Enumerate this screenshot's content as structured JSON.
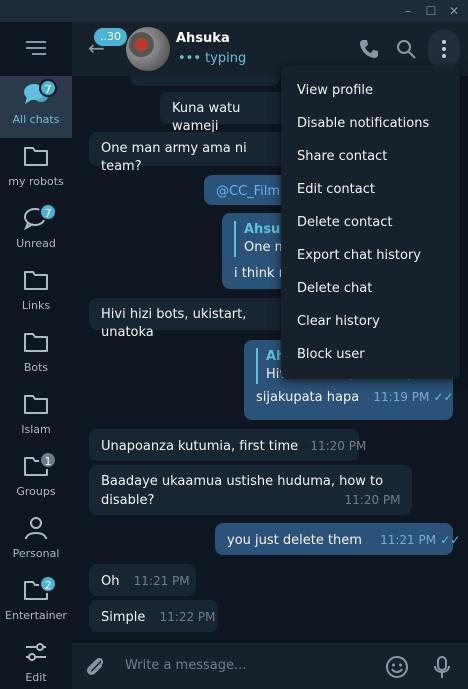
{
  "window": {
    "minimize_glyph": "–",
    "maximize_glyph": "☐",
    "close_glyph": "✕"
  },
  "sidebar": {
    "folders": [
      {
        "label": "All chats",
        "badge": "7",
        "icon": "chat-bubbles-icon",
        "active": true
      },
      {
        "label": "my robots",
        "badge": "",
        "icon": "folder-icon"
      },
      {
        "label": "Unread",
        "badge": "7",
        "icon": "chat-bubble-icon"
      },
      {
        "label": "Links",
        "badge": "",
        "icon": "folder-icon"
      },
      {
        "label": "Bots",
        "badge": "",
        "icon": "folder-icon"
      },
      {
        "label": "Islam",
        "badge": "",
        "icon": "folder-icon"
      },
      {
        "label": "Groups",
        "badge": "1",
        "icon": "folder-icon"
      },
      {
        "label": "Personal",
        "badge": "",
        "icon": "person-icon"
      },
      {
        "label": "Entertainer",
        "badge": "2",
        "icon": "folder-icon"
      },
      {
        "label": "Edit",
        "badge": "",
        "icon": "sliders-icon"
      }
    ]
  },
  "header": {
    "back_badge": "..30",
    "name": "Ahsuka",
    "status": "••• typing"
  },
  "messages": {
    "m1": {
      "text": "Kuna watu wameji"
    },
    "m2": {
      "text": "One man army ama ni team?"
    },
    "m3": {
      "text": "@CC_Filmo"
    },
    "m4": {
      "reply_name": "Ahsuk",
      "reply_text": "One m",
      "text": "i think n"
    },
    "m5": {
      "text": "Hivi hizi bots, ukistart, unatoka"
    },
    "m6": {
      "reply_name": "Ah",
      "reply_text": "Hivi hizi bots, ukistart, unat...",
      "text": "sijakupata hapa",
      "time": "11:19 PM"
    },
    "m7": {
      "text": "Unapoanza kutumia, first time",
      "time": "11:20 PM"
    },
    "m8": {
      "text_line1": "Baadaye ukaamua ustishe huduma, how to",
      "text_line2": "disable?",
      "time": "11:20 PM"
    },
    "m9": {
      "text": "you just delete them",
      "time": "11:21 PM"
    },
    "m10": {
      "text": "Oh",
      "time": "11:21 PM"
    },
    "m11": {
      "text": "Simple",
      "time": "11:22 PM"
    }
  },
  "dropdown": {
    "items": [
      "View profile",
      "Disable notifications",
      "Share contact",
      "Edit contact",
      "Delete contact",
      "Export chat history",
      "Delete chat",
      "Clear history",
      "Block user"
    ]
  },
  "composer": {
    "placeholder": "Write a message..."
  },
  "colors": {
    "accent": "#5fc1de",
    "incoming_bubble": "#182533",
    "outgoing_bubble": "#2b5278",
    "background": "#0e1621",
    "panel": "#17212b"
  }
}
